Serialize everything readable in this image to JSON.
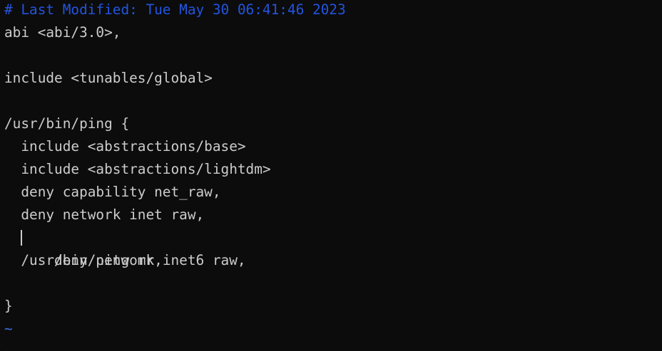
{
  "editor": {
    "comment_line": "# Last Modified: Tue May 30 06:41:46 2023",
    "lines": [
      "abi <abi/3.0>,",
      "",
      "include <tunables/global>",
      "",
      "/usr/bin/ping {",
      "  include <abstractions/base>",
      "  include <abstractions/lightdm>",
      "  deny capability net_raw,",
      "  deny network inet raw,",
      "  deny network inet6 raw,",
      "  /usr/bin/ping mr,",
      "",
      "}"
    ],
    "empty_line_marker": "~",
    "cursor_line_index": 9
  }
}
